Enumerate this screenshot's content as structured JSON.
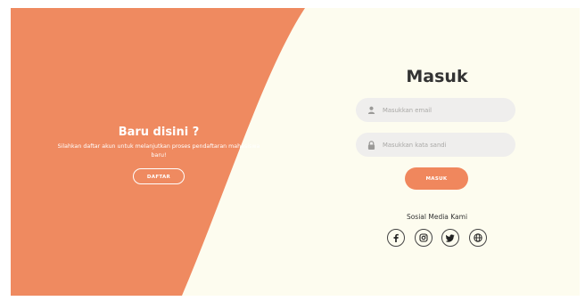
{
  "signup": {
    "title": "Baru disini ?",
    "description": "Silahkan daftar akun untuk melanjutkan proses pendaftaran mahasiswa baru!",
    "register_label": "DAFTAR"
  },
  "login": {
    "title": "Masuk",
    "email_placeholder": "Masukkan email",
    "password_placeholder": "Masukkan kata sandi",
    "submit_label": "MASUK"
  },
  "social": {
    "title": "Sosial Media Kami",
    "icons": [
      "facebook-icon",
      "instagram-icon",
      "twitter-icon",
      "globe-icon"
    ]
  },
  "colors": {
    "accent": "#ef8a60",
    "background": "#fdfcef",
    "field_background": "#efeeed",
    "button": "#f0875d"
  }
}
